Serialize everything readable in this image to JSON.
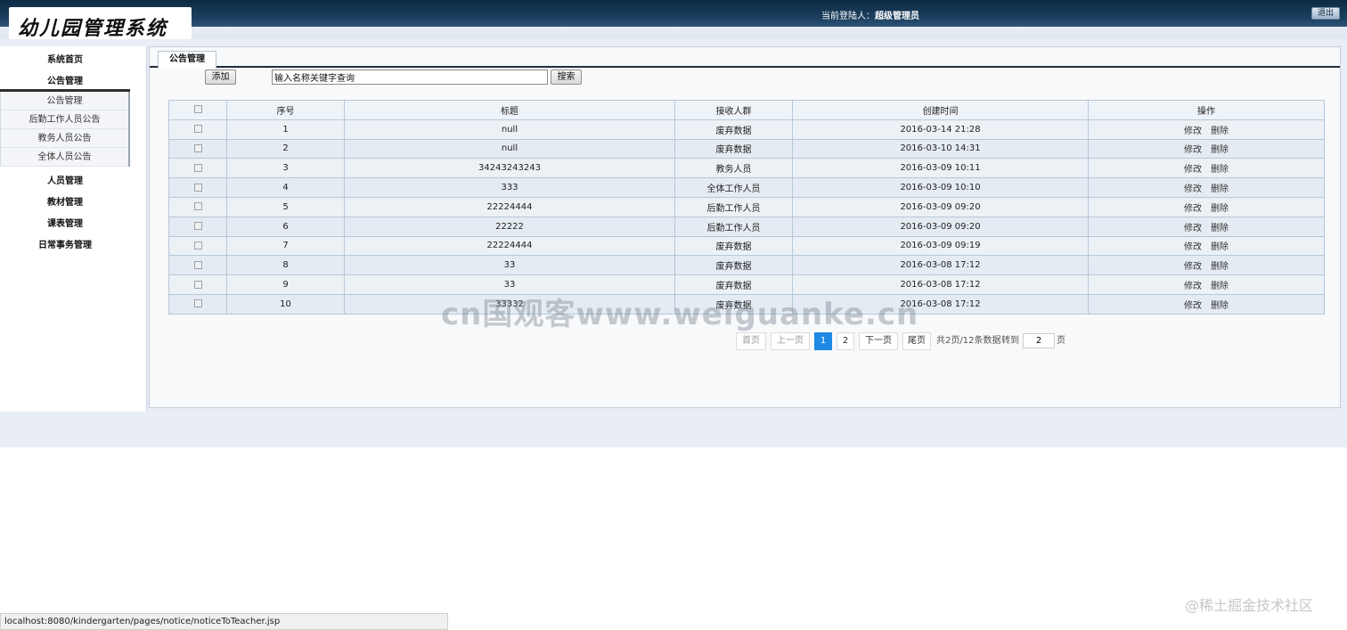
{
  "header": {
    "logo_text": "幼儿园管理系统",
    "user_label": "当前登陆人：",
    "user_name": "超级管理员",
    "logout_label": "退出"
  },
  "sidebar": {
    "items": [
      {
        "label": "系统首页"
      },
      {
        "label": "公告管理"
      },
      {
        "label": "人员管理"
      },
      {
        "label": "教材管理"
      },
      {
        "label": "课表管理"
      },
      {
        "label": "日常事务管理"
      }
    ],
    "sub_items": [
      {
        "label": "公告管理"
      },
      {
        "label": "后勤工作人员公告"
      },
      {
        "label": "教务人员公告"
      },
      {
        "label": "全体人员公告"
      }
    ]
  },
  "panel": {
    "tab_label": "公告管理",
    "add_label": "添加",
    "search_value": "输入名称关键字查询",
    "search_label": "搜索"
  },
  "table": {
    "columns": [
      "序号",
      "标题",
      "接收人群",
      "创建时间",
      "操作"
    ],
    "edit_label": "修改",
    "delete_label": "删除",
    "rows": [
      {
        "no": "1",
        "title": "null",
        "audience": "废弃数据",
        "created": "2016-03-14 21:28"
      },
      {
        "no": "2",
        "title": "null",
        "audience": "废弃数据",
        "created": "2016-03-10 14:31"
      },
      {
        "no": "3",
        "title": "34243243243",
        "audience": "教务人员",
        "created": "2016-03-09 10:11"
      },
      {
        "no": "4",
        "title": "333",
        "audience": "全体工作人员",
        "created": "2016-03-09 10:10"
      },
      {
        "no": "5",
        "title": "22224444",
        "audience": "后勤工作人员",
        "created": "2016-03-09 09:20"
      },
      {
        "no": "6",
        "title": "22222",
        "audience": "后勤工作人员",
        "created": "2016-03-09 09:20"
      },
      {
        "no": "7",
        "title": "22224444",
        "audience": "废弃数据",
        "created": "2016-03-09 09:19"
      },
      {
        "no": "8",
        "title": "33",
        "audience": "废弃数据",
        "created": "2016-03-08 17:12"
      },
      {
        "no": "9",
        "title": "33",
        "audience": "废弃数据",
        "created": "2016-03-08 17:12"
      },
      {
        "no": "10",
        "title": "33332",
        "audience": "废弃数据",
        "created": "2016-03-08 17:12"
      }
    ]
  },
  "pager": {
    "first": "首页",
    "prev": "上一页",
    "page1": "1",
    "page2": "2",
    "next": "下一页",
    "last": "尾页",
    "summary": "共2页/12条数据",
    "goto_label": "转到",
    "goto_value": "2",
    "page_suffix": "页"
  },
  "watermark": "cn国观客www.weiguanke.cn",
  "status_url": "localhost:8080/kindergarten/pages/notice/noticeToTeacher.jsp",
  "credit": "@稀土掘金技术社区"
}
